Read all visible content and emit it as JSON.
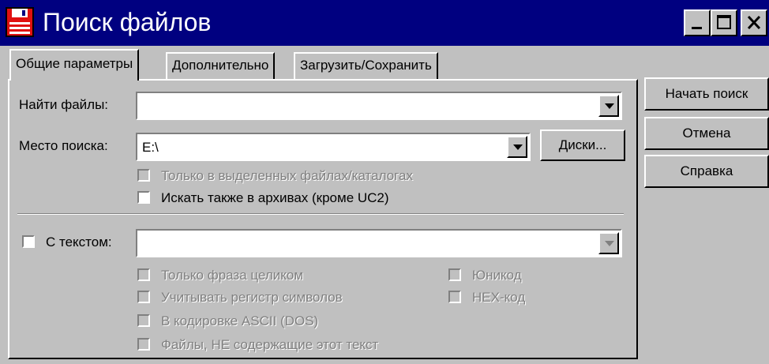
{
  "window": {
    "title": "Поиск файлов",
    "title_bar_color": "#000080"
  },
  "title_buttons": [
    {
      "name": "minimize-icon"
    },
    {
      "name": "maximize-icon"
    },
    {
      "name": "close-icon"
    }
  ],
  "tabs": [
    {
      "label": "Общие параметры",
      "active": true
    },
    {
      "label": "Дополнительно",
      "active": false
    },
    {
      "label": "Загрузить/Сохранить",
      "active": false
    }
  ],
  "find_files": {
    "label": "Найти файлы:",
    "value": ""
  },
  "search_location": {
    "label": "Место поиска:",
    "value": "E:\\",
    "drives_button": "Диски..."
  },
  "options": {
    "only_selected": {
      "label": "Только в выделенных файлах/каталогах",
      "enabled": false,
      "checked": false
    },
    "search_archives": {
      "label": "Искать также в архивах (кроме UC2)",
      "enabled": true,
      "checked": false
    }
  },
  "with_text": {
    "label": "С текстом:",
    "checked": false,
    "value": ""
  },
  "text_options": {
    "whole_phrase": "Только фраза целиком",
    "unicode": "Юникод",
    "case_sensitive": "Учитывать регистр символов",
    "hex": "HEX-код",
    "ascii": "В кодировке ASCII (DOS)",
    "not_containing": "Файлы, НЕ содержащие этот текст"
  },
  "actions": {
    "start_search": "Начать поиск",
    "cancel": "Отмена",
    "help": "Справка"
  }
}
